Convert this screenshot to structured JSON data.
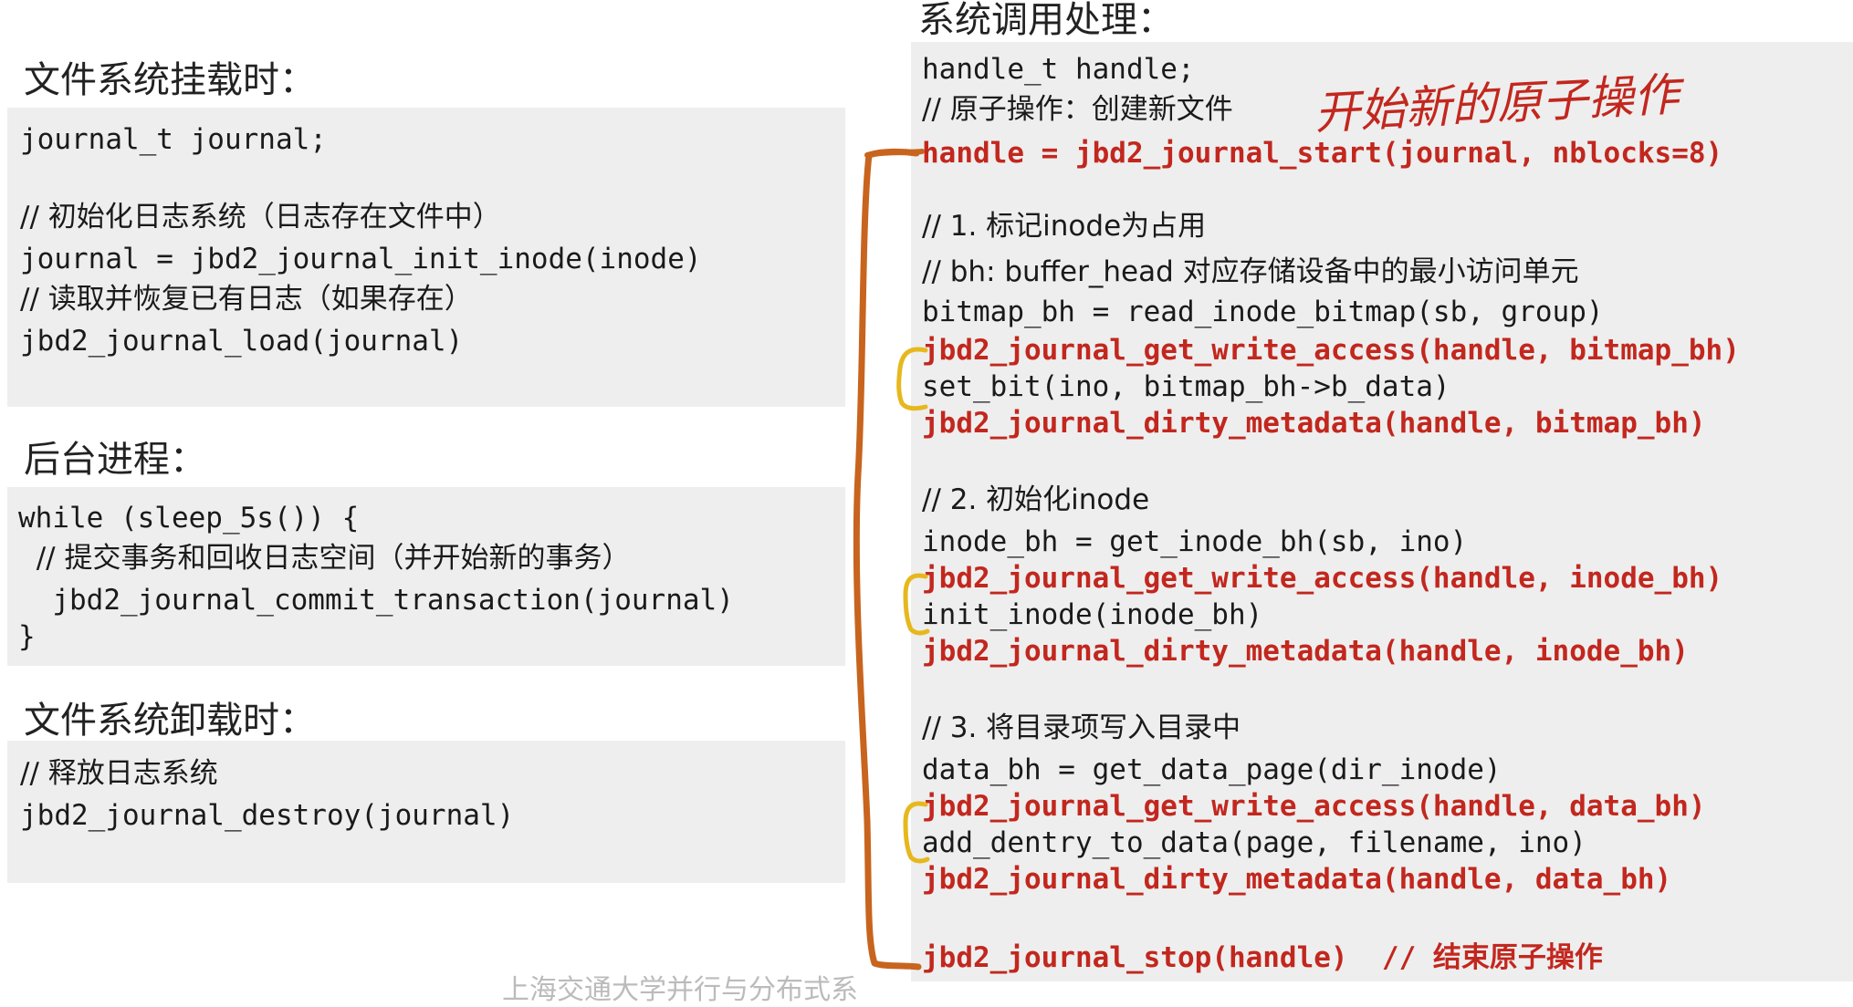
{
  "left": {
    "mount": {
      "title": "文件系统挂载时：",
      "lines": [
        "journal_t journal;",
        "",
        "// 初始化日志系统（日志存在文件中）",
        "journal = jbd2_journal_init_inode(inode)",
        "// 读取并恢复已有日志（如果存在）",
        "jbd2_journal_load(journal)"
      ]
    },
    "background": {
      "title": "后台进程：",
      "lines": [
        "while (sleep_5s()) {",
        "  // 提交事务和回收日志空间（并开始新的事务）",
        "  jbd2_journal_commit_transaction(journal)",
        "}"
      ]
    },
    "unmount": {
      "title": "文件系统卸载时：",
      "lines": [
        "// 释放日志系统",
        "jbd2_journal_destroy(journal)"
      ]
    }
  },
  "right": {
    "title": "系统调用处理：",
    "lines": [
      "handle_t handle;",
      "// 原子操作：创建新文件",
      "handle = jbd2_journal_start(journal, nblocks=8)",
      "// 1. 标记inode为占用",
      "// bh: buffer_head 对应存储设备中的最小访问单元",
      "bitmap_bh = read_inode_bitmap(sb, group)",
      "jbd2_journal_get_write_access(handle, bitmap_bh)",
      "set_bit(ino, bitmap_bh->b_data)",
      "jbd2_journal_dirty_metadata(handle, bitmap_bh)",
      "// 2. 初始化inode",
      "inode_bh = get_inode_bh(sb, ino)",
      "jbd2_journal_get_write_access(handle, inode_bh)",
      "init_inode(inode_bh)",
      "jbd2_journal_dirty_metadata(handle, inode_bh)",
      "// 3. 将目录项写入目录中",
      "data_bh = get_data_page(dir_inode)",
      "jbd2_journal_get_write_access(handle, data_bh)",
      "add_dentry_to_data(page, filename, ino)",
      "jbd2_journal_dirty_metadata(handle, data_bh)",
      "jbd2_journal_stop(handle)  // 结束原子操作"
    ]
  },
  "annotation": {
    "handwritten_note": "开始新的原子操作"
  },
  "footer": "上海交通大学并行与分布式系",
  "colors": {
    "code_highlight": "#c2271e",
    "box_bg": "#eeeeee",
    "bracket_orange": "#c8641e",
    "bracket_yellow": "#e6b81e"
  }
}
